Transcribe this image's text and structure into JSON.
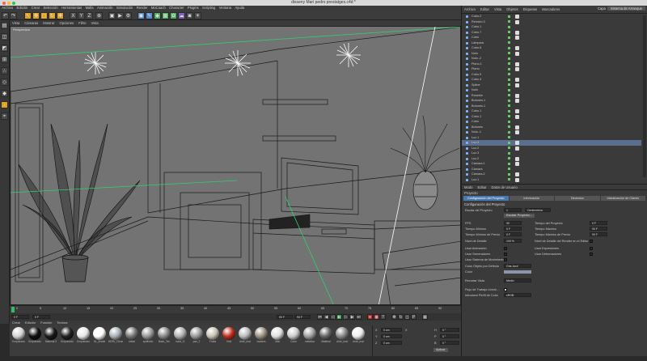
{
  "window": {
    "title": "disseny Mari pedro prestatges.c4d *"
  },
  "menubar": [
    "Archivo",
    "Edición",
    "Crear",
    "Selección",
    "Herramientas",
    "Malla",
    "Animación",
    "Simulación",
    "Render",
    "MoCoach",
    "Character",
    "Plugins",
    "Scripting",
    "Ventana",
    "Ayuda"
  ],
  "viewport": {
    "menu": [
      "Vista",
      "Cámaras",
      "Mostrar",
      "Opciones",
      "Filtro",
      "Vista"
    ],
    "label": "Perspectiva"
  },
  "timeline": {
    "ticks": [
      "0",
      "5",
      "10",
      "15",
      "20",
      "25",
      "30",
      "35",
      "40",
      "45",
      "50",
      "55",
      "60",
      "65",
      "70",
      "75",
      "80",
      "85",
      "90"
    ],
    "current_frame": "0 F",
    "start": "0 F",
    "end": "90 F",
    "end2": "90 F"
  },
  "materials": {
    "menu": [
      "Crear",
      "Edición",
      "Función",
      "Textura"
    ],
    "items": [
      {
        "label": "Empotrado",
        "color": "#d4d4d4"
      },
      {
        "label": "Empotrado",
        "color": "#111111"
      },
      {
        "label": "Material 3",
        "color": "#1a1a1a"
      },
      {
        "label": "Empotrado",
        "color": "#222222"
      },
      {
        "label": "Empotrado",
        "color": "#e8e8e8"
      },
      {
        "label": "HL_Inside",
        "color": "#ffffff"
      },
      {
        "label": "HDRI_Chrome",
        "color": "#aab0b8"
      },
      {
        "label": "metal",
        "color": "#777777"
      },
      {
        "label": "synthetic",
        "color": "#999999"
      },
      {
        "label": "Base_Tex",
        "color": "#888888"
      },
      {
        "label": "back_G",
        "color": "#b0b0b0"
      },
      {
        "label": "pan_2",
        "color": "#9a9a9a"
      },
      {
        "label": "Fusta",
        "color": "#c8c0b4"
      },
      {
        "label": "Vinil",
        "color": "#c03020"
      },
      {
        "label": "Ante_mat",
        "color": "#bbbbbb"
      },
      {
        "label": "madera",
        "color": "#9a8f82"
      },
      {
        "label": "Mat",
        "color": "#e0e0e0"
      },
      {
        "label": "Color",
        "color": "#cccccc"
      },
      {
        "label": "metalica",
        "color": "#a0a0a0"
      },
      {
        "label": "Material",
        "color": "#666666"
      },
      {
        "label": "Ante_mat",
        "color": "#888888"
      },
      {
        "label": "Ante_mat",
        "color": "#eeeeee"
      }
    ]
  },
  "coords": {
    "x": "0 cm",
    "y": "0 cm",
    "z": "0 cm",
    "h": "0 °",
    "p": "0 °",
    "b": "0 °",
    "apply": "Aplicar"
  },
  "objects": {
    "menu": [
      "Archivo",
      "Editar",
      "Vista",
      "Objetos",
      "Etiquetas",
      "Marcadores"
    ],
    "layout_label": "Capa",
    "layout_value": "Sistema de Arranque",
    "rows": [
      "Cubo.2",
      "Reinicio.3",
      "Cubo.1",
      "Cubo.7",
      "Cubo",
      "Lámpara",
      "Cubo.8",
      "Nulo",
      "Nulo..2",
      "Plano.1",
      "Plano",
      "Cubo.9",
      "Cubo.4",
      "Spline",
      "Nulo",
      "Rosetón",
      "Botones.1",
      "Botones.1",
      "Cubo.1",
      "Cubo.1",
      "Cubo",
      "Botones",
      "Nulo..1",
      "Luz.1",
      "Luz.4",
      "Luz.2",
      "Luz.3",
      "Luz.2",
      "Cámara.1",
      "Cámara",
      "Cámara.2",
      "Luz.1"
    ]
  },
  "attributes": {
    "menu": [
      "Modo",
      "Editar",
      "Datos de Usuario"
    ],
    "title": "Proyecto",
    "tabs": [
      "Configuración del Proyecto",
      "Información",
      "Dinámica",
      "Inicialización de Claves"
    ],
    "section": "Configuración del Proyecto",
    "scale_label": "Escala del Proyecto",
    "scale_value": "1",
    "scale_unit": "Centímetros",
    "scale_button": "Escalar Proyecto...",
    "left_fields": [
      {
        "label": "FPS",
        "value": "30"
      },
      {
        "label": "Tiempo Mínimo",
        "value": "0 F"
      },
      {
        "label": "Tiempo Mínimo de Previo",
        "value": "0 F"
      }
    ],
    "right_fields": [
      {
        "label": "Tiempo del Proyecto",
        "value": "0 F"
      },
      {
        "label": "Tiempo Máximo",
        "value": "90 F"
      },
      {
        "label": "Tiempo Máximo de Previo",
        "value": "90 F"
      }
    ],
    "lod_label": "Nivel de Detalle",
    "lod_value": "100 %",
    "lod_editor": "Nivel de Detalle del Render en el Editor",
    "check_left": [
      "Usar Animación",
      "Usar Generadores",
      "Usar Sistema de Movimiento"
    ],
    "check_right": [
      "Usar Expresiones",
      "Usar Deformadores"
    ],
    "color_label": "Color Objeto por Defecto",
    "color_value": "Gris-Azul",
    "color2_label": "Color",
    "clip_label": "Recortar Vista",
    "clip_value": "Medio",
    "linear_label": "Flujo de Trabajo Lineal....",
    "profile_label": "Introducir Perfil de Color",
    "profile_value": "sRGB"
  }
}
